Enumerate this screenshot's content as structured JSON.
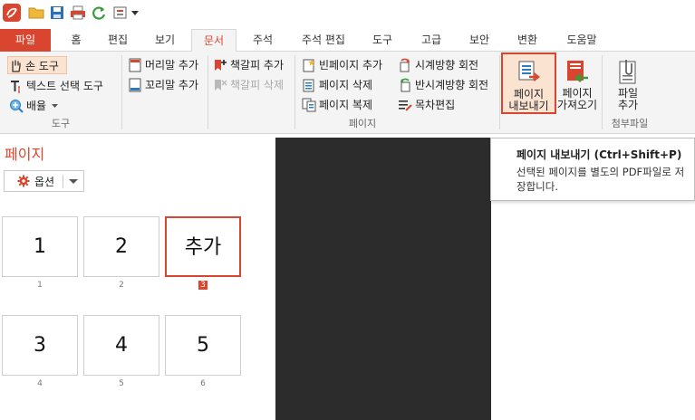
{
  "quick_access": {
    "icons": [
      "app-logo-icon",
      "open-folder-icon",
      "save-icon",
      "print-icon",
      "refresh-icon",
      "window-options-icon",
      "dropdown-arrow-icon"
    ]
  },
  "tabs": [
    {
      "label": "파일",
      "kind": "file"
    },
    {
      "label": "홈"
    },
    {
      "label": "편집"
    },
    {
      "label": "보기"
    },
    {
      "label": "문서",
      "active": true
    },
    {
      "label": "주석"
    },
    {
      "label": "주석 편집"
    },
    {
      "label": "도구"
    },
    {
      "label": "고급"
    },
    {
      "label": "보안"
    },
    {
      "label": "변환"
    },
    {
      "label": "도움말"
    }
  ],
  "ribbon": {
    "tools_group": {
      "hand_tool": "손 도구",
      "text_select": "텍스트 선택 도구",
      "zoom": "배율",
      "label": "도구"
    },
    "header_group": {
      "header_add": "머리말 추가",
      "footer_add": "꼬리말 추가"
    },
    "bookmark_group": {
      "bookmark_add": "책갈피 추가",
      "bookmark_delete": "책갈피 삭제"
    },
    "page_group": {
      "blank_add": "빈페이지 추가",
      "page_delete": "페이지 삭제",
      "page_copy": "페이지 복제",
      "rotate_cw": "시계방향 회전",
      "rotate_ccw": "반시계방향 회전",
      "toc_edit": "목차편집",
      "label": "페이지"
    },
    "export_btn": {
      "line1": "페이지",
      "line2": "내보내기"
    },
    "import_btn": {
      "line1": "페이지",
      "line2": "가져오기"
    },
    "attach_group": {
      "attach_btn": {
        "line1": "파일",
        "line2": "추가"
      },
      "label": "첨부파일"
    }
  },
  "panel": {
    "title": "페이지",
    "options_label": "옵션",
    "pages": [
      {
        "content": "1",
        "number": "1"
      },
      {
        "content": "2",
        "number": "2"
      },
      {
        "content": "추가",
        "number": "3",
        "selected": true
      },
      {
        "content": "3",
        "number": "4"
      },
      {
        "content": "4",
        "number": "5"
      },
      {
        "content": "5",
        "number": "6"
      }
    ]
  },
  "tooltip": {
    "title": "페이지 내보내기 (Ctrl+Shift+P)",
    "body": "선택된 페이지를 별도의 PDF파일로 저장합니다."
  },
  "colors": {
    "accent": "#d9452e",
    "ribbon_bg": "#f4f4f4",
    "doc_bg": "#2c2c2c",
    "highlight_bg": "#fbe3d2"
  }
}
